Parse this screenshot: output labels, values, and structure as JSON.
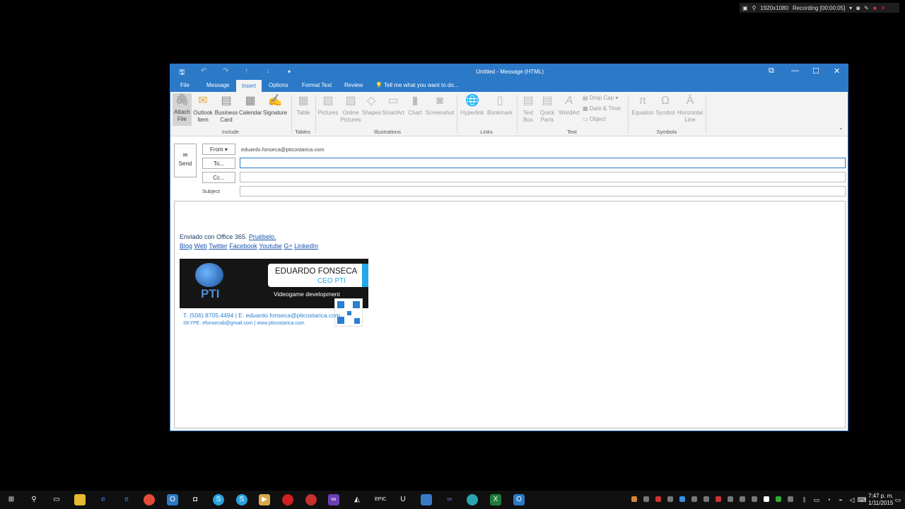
{
  "recorder": {
    "resolution": "1920x1080",
    "status": "Recording [00:00:05]"
  },
  "window": {
    "title": "Untitled - Message (HTML)"
  },
  "tabs": [
    {
      "label": "File"
    },
    {
      "label": "Message"
    },
    {
      "label": "Insert"
    },
    {
      "label": "Options"
    },
    {
      "label": "Format Text"
    },
    {
      "label": "Review"
    }
  ],
  "tell_me": "Tell me what you want to do...",
  "ribbon": {
    "include": {
      "attach_file": "Attach File",
      "outlook_item": "Outlook Item",
      "business_card": "Business Card",
      "calendar": "Calendar",
      "signature": "Signature",
      "label": "Include"
    },
    "tables": {
      "table": "Table",
      "label": "Tables"
    },
    "illustrations": {
      "pictures": "Pictures",
      "online_pictures": "Online Pictures",
      "shapes": "Shapes",
      "smartart": "SmartArt",
      "chart": "Chart",
      "screenshot": "Screenshot",
      "label": "Illustrations"
    },
    "links": {
      "hyperlink": "Hyperlink",
      "bookmark": "Bookmark",
      "label": "Links"
    },
    "text": {
      "text_box": "Text Box",
      "quick_parts": "Quick Parts",
      "wordart": "WordArt",
      "drop_cap": "Drop Cap",
      "date_time": "Date & Time",
      "object": "Object",
      "label": "Text"
    },
    "symbols": {
      "equation": "Equation",
      "symbol": "Symbol",
      "horizontal_line": "Horizontal Line",
      "label": "Symbols"
    }
  },
  "compose": {
    "send": "Send",
    "from_button": "From ▾",
    "from_value": "eduardo.fonseca@pticostarica.com",
    "to_button": "To...",
    "cc_button": "Cc...",
    "subject_label": "Subject",
    "to_value": "",
    "cc_value": "",
    "subject_value": ""
  },
  "body": {
    "sent_with": "Enviado con Office 365.",
    "try_it": "Pruébelo.",
    "links": [
      "Blog",
      "Web",
      "Twitter",
      "Facebook",
      "Youtube",
      "G+",
      "LinkedIn"
    ]
  },
  "signature": {
    "name": "EDUARDO FONSECA",
    "role": "CEO PTI",
    "logo": "PTI",
    "tagline": "Videogame development",
    "line1": "T. (506) 8705.4494 | E. eduardo.fonseca@pticostarica.com",
    "line2": "SKYPE. efonsecab@gmail.com | www.pticostarica.com"
  },
  "taskbar": {
    "time": "7:47 p. m.",
    "date": "1/11/2015"
  },
  "colors": {
    "accent": "#2b79c7",
    "link": "#1a55b0"
  }
}
